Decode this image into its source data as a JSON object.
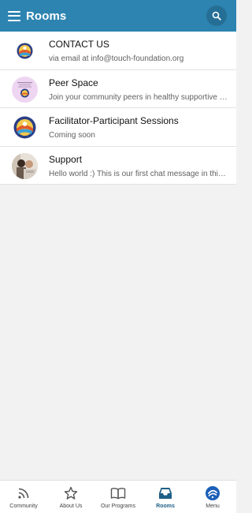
{
  "header": {
    "title": "Rooms"
  },
  "rooms": [
    {
      "name": "CONTACT US",
      "subtitle": "via email at info@touch-foundation.org"
    },
    {
      "name": "Peer Space",
      "subtitle": "Join your community peers in healthy supportive conversations"
    },
    {
      "name": "Facilitator-Participant Sessions",
      "subtitle": "Coming soon"
    },
    {
      "name": "Support",
      "subtitle": "Hello world :) This is our first chat message in this room"
    }
  ],
  "bottom_nav": {
    "items": [
      {
        "label": "Community",
        "icon": "rss-icon"
      },
      {
        "label": "About Us",
        "icon": "star-icon"
      },
      {
        "label": "Our Programs",
        "icon": "book-icon"
      },
      {
        "label": "Rooms",
        "icon": "inbox-icon",
        "active": true
      },
      {
        "label": "Menu",
        "icon": "logo-icon"
      }
    ]
  },
  "colors": {
    "header": "#2d84b1",
    "active_nav": "#1f5f86"
  }
}
